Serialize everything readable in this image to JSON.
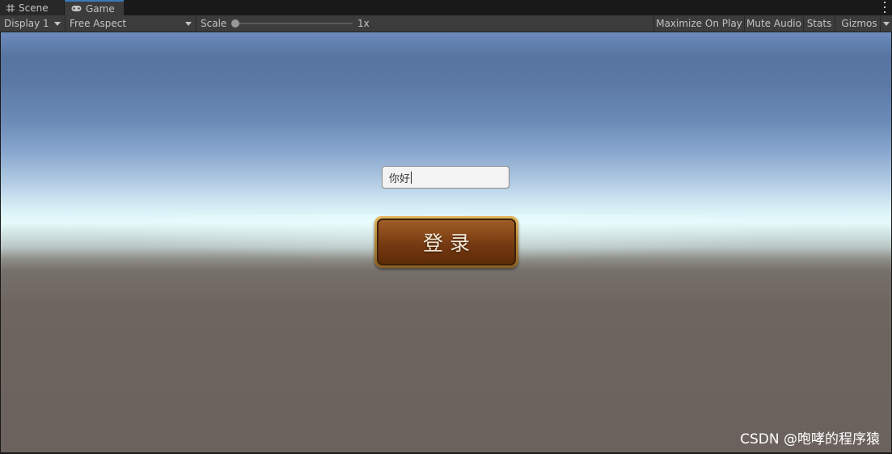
{
  "tabs": [
    {
      "label": "Scene",
      "icon": "grid-icon"
    },
    {
      "label": "Game",
      "icon": "gamepad-icon"
    }
  ],
  "toolbar": {
    "display": "Display 1",
    "aspect": "Free Aspect",
    "scale_label": "Scale",
    "scale_value": "1x",
    "scale_level": 0,
    "maximize": "Maximize On Play",
    "mute": "Mute Audio",
    "stats": "Stats",
    "gizmos": "Gizmos"
  },
  "game": {
    "input_value": "你好",
    "login_label": "登录"
  },
  "watermark": "CSDN @咆哮的程序猿",
  "colors": {
    "accent": "#3a79bb",
    "editor_bg": "#3c3c3c",
    "button_brown": "#7a3f14",
    "button_gold": "#d2a654"
  }
}
